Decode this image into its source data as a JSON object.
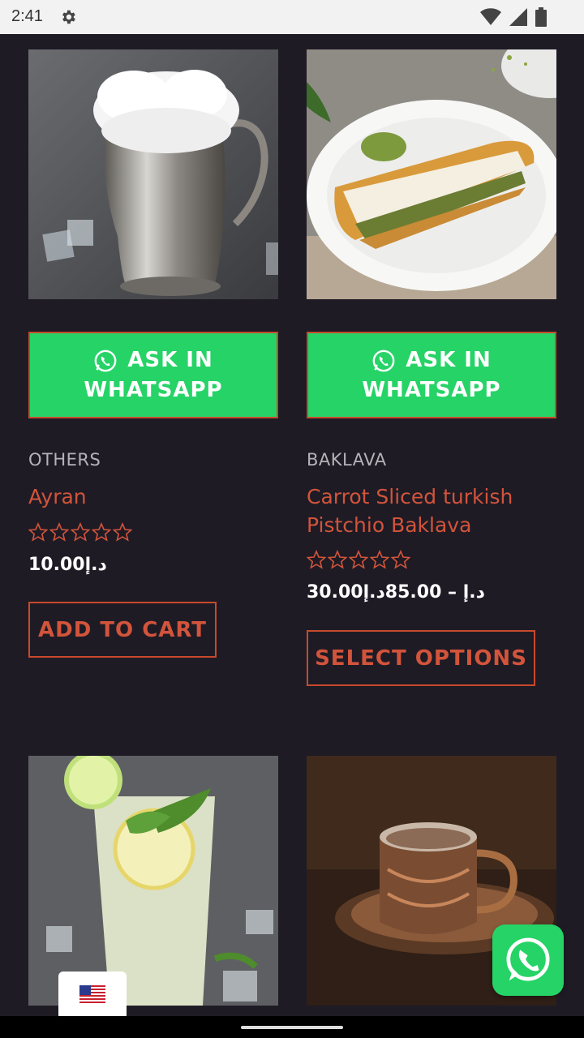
{
  "status_bar": {
    "time": "2:41",
    "icons": [
      "gear-icon",
      "wifi-icon",
      "signal-icon",
      "battery-icon"
    ]
  },
  "products": [
    {
      "image": "ayran-jug-image",
      "whatsapp_label_line1": "ASK IN",
      "whatsapp_label_line2": "WHATSAPP",
      "category": "OTHERS",
      "title_line1": "Ayran",
      "title_line2": "",
      "rating": 0,
      "price": "10.00د.إ",
      "action_label": "ADD TO CART"
    },
    {
      "image": "baklava-plate-image",
      "whatsapp_label_line1": "ASK IN",
      "whatsapp_label_line2": "WHATSAPP",
      "category": "BAKLAVA",
      "title_line1": "Carrot Sliced turkish",
      "title_line2": "Pistchio Baklava",
      "rating": 0,
      "price": "30.00د.إ – 85.00د.إ",
      "action_label": "SELECT OPTIONS"
    },
    {
      "image": "lemonade-glass-image"
    },
    {
      "image": "turkish-coffee-image"
    }
  ],
  "floating_whatsapp": {
    "icon": "whatsapp-icon"
  },
  "language_switcher": {
    "icon": "us-flag-icon"
  },
  "colors": {
    "background": "#1e1b25",
    "whatsapp_green": "#26d367",
    "accent": "#d2543b"
  }
}
